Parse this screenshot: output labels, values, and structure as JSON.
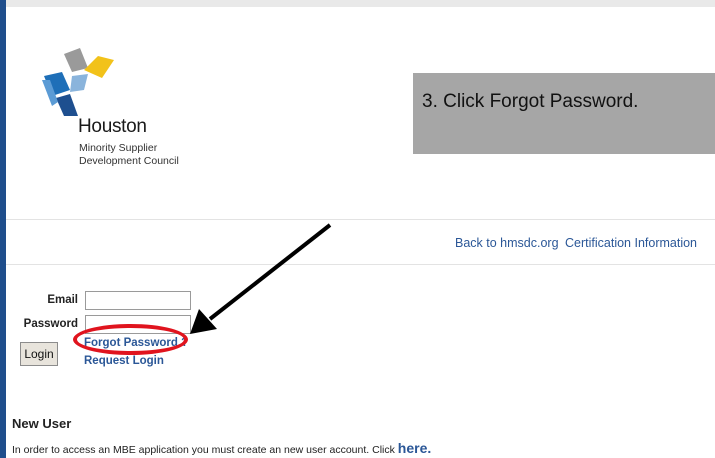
{
  "logo": {
    "name": "Houston",
    "subtitle_line1": "Minority Supplier",
    "subtitle_line2": "Development Council"
  },
  "callout": {
    "text": "3. Click Forgot Password."
  },
  "nav": {
    "back_link": "Back to hmsdc.org",
    "cert_link": "Certification Information"
  },
  "login_form": {
    "email_label": "Email",
    "email_value": "",
    "password_label": "Password",
    "password_value": "",
    "login_button": "Login",
    "forgot_password_link": "Forgot Password ?",
    "request_login_link": "Request Login"
  },
  "new_user": {
    "heading": "New User",
    "text": "In order to access an MBE application you must create an new user account. Click ",
    "here_link": "here."
  },
  "colors": {
    "link_blue": "#2b5797",
    "annotation_red": "#e0141e",
    "callout_gray": "#a6a6a6",
    "left_bar": "#1f4e8c"
  }
}
